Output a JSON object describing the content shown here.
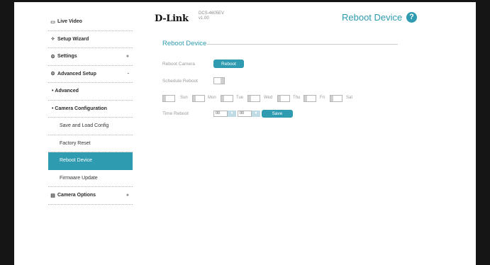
{
  "sidebar": {
    "live_video": "Live Video",
    "setup_wizard": "Setup Wizard",
    "settings": "Settings",
    "settings_toggle": "+",
    "advanced_setup": "Advanced Setup",
    "advanced_setup_toggle": "-",
    "advanced": "Advanced",
    "camera_configuration": "Camera Configuration",
    "save_and_load_config": "Save and Load Config",
    "factory_reset": "Factory Reset",
    "reboot_device": "Reboot Device",
    "firmware_update": "Firmware Update",
    "camera_options": "Camera Options",
    "camera_options_toggle": "+"
  },
  "header": {
    "logo": "D-Link",
    "model": "DCS-4605EV",
    "version": "v1.00",
    "page_title": "Reboot Device",
    "help": "?"
  },
  "content": {
    "section_title": "Reboot Device",
    "reboot_camera_label": "Reboot Camera",
    "reboot_button": "Reboot",
    "schedule_reboot_label": "Schedule Reboot",
    "days": [
      "Sun",
      "Mon",
      "Tue",
      "Wed",
      "Thu",
      "Fri",
      "Sat"
    ],
    "time_reboot_label": "Time Reboot",
    "hour_value": "00",
    "minute_value": "00",
    "save_button": "Save"
  },
  "colors": {
    "accent": "#2e9bb0",
    "frame": "#151515"
  }
}
